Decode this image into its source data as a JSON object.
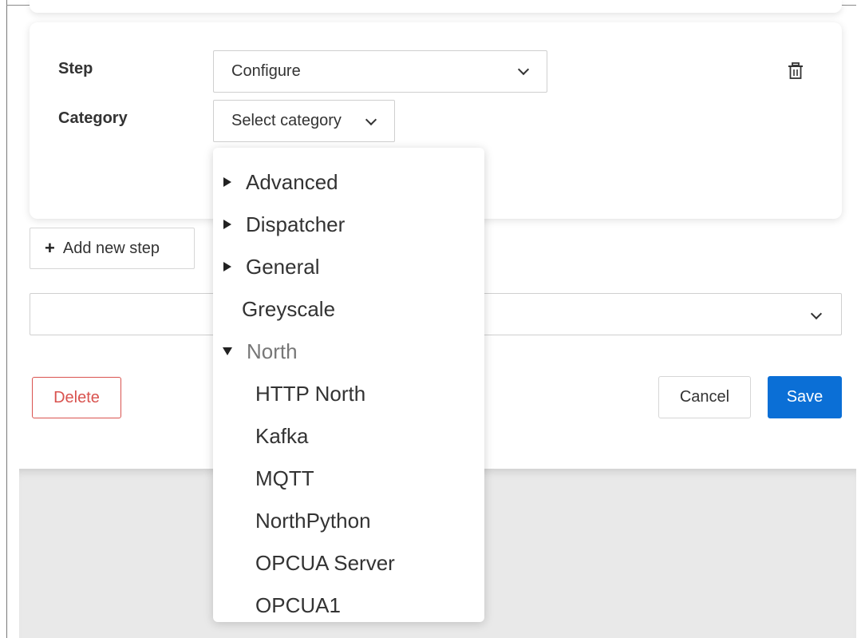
{
  "form": {
    "step_label": "Step",
    "step_value": "Configure",
    "category_label": "Category",
    "category_placeholder": "Select category",
    "add_step_label": "Add new step",
    "add_step_icon": "+"
  },
  "actions": {
    "delete_label": "Delete",
    "cancel_label": "Cancel",
    "save_label": "Save"
  },
  "colors": {
    "save_bg": "#0b6fd6",
    "delete_border": "#d9534f"
  },
  "dropdown": {
    "items": [
      {
        "label": "Advanced",
        "kind": "collapsed"
      },
      {
        "label": "Dispatcher",
        "kind": "collapsed"
      },
      {
        "label": "General",
        "kind": "collapsed"
      },
      {
        "label": "Greyscale",
        "kind": "leaf"
      },
      {
        "label": "North",
        "kind": "expanded"
      },
      {
        "label": "HTTP North",
        "kind": "child"
      },
      {
        "label": "Kafka",
        "kind": "child"
      },
      {
        "label": "MQTT",
        "kind": "child"
      },
      {
        "label": "NorthPython",
        "kind": "child"
      },
      {
        "label": "OPCUA Server",
        "kind": "child"
      },
      {
        "label": "OPCUA1",
        "kind": "child"
      }
    ]
  }
}
